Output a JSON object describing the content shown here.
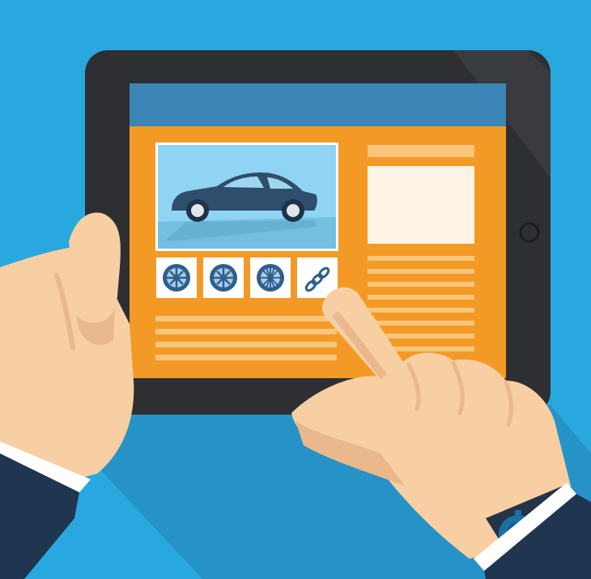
{
  "scene": {
    "subject": "tablet-held-by-hands",
    "icons": [
      "car-icon",
      "wheel-icon",
      "wheel-icon",
      "wheel-icon",
      "chain-link-icon"
    ],
    "colors": {
      "background": "#29a8df",
      "shadow": "#2593c7",
      "tablet_bezel": "#2e2f33",
      "screen_header": "#3b86b6",
      "screen_body": "#f39a26",
      "image_panel": "#7fd0f0",
      "car": "#2e4e6b",
      "tile": "#ffffff",
      "text_lines": "#f8c57a",
      "right_box": "#fdf4e5",
      "skin": "#f7cfa2",
      "skin_shadow": "#e9b88c",
      "sleeve": "#1f3550",
      "cuff": "#ffffff",
      "watch": "#1c6fa3"
    }
  }
}
